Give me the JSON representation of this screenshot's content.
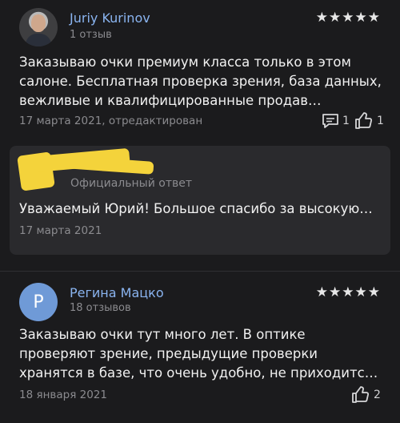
{
  "reviews": [
    {
      "author": "Juriy Kurinov",
      "reviews_count": "1 отзыв",
      "rating": 5,
      "stars": "★★★★★",
      "text": "Заказываю очки премиум класса только в этом салоне. Бесплатная проверка зрения, база данных, вежливые и квалифицированные продав…",
      "date": "17 марта 2021, отредактирован",
      "comments_count": "1",
      "likes_count": "1",
      "reply": {
        "label": "Официальный ответ",
        "text": "Уважаемый Юрий! Большое спасибо за высокую…",
        "date": "17 марта 2021"
      }
    },
    {
      "author": "Регина Мацко",
      "avatar_letter": "Р",
      "avatar_color": "#6f9ad7",
      "reviews_count": "18 отзывов",
      "rating": 5,
      "stars": "★★★★★",
      "text": "Заказываю очки тут много лет. В оптике проверяют зрение, предыдущие проверки хранятся в базе, что очень удобно, не приходитс…",
      "date": "18 января 2021",
      "likes_count": "2"
    }
  ],
  "icons": {
    "comment": "comment-icon",
    "like": "thumbs-up-icon",
    "redaction": "redaction-mark"
  },
  "colors": {
    "background": "#1b1b1d",
    "card": "#2a2a2d",
    "author": "#8ab4f0",
    "secondary": "#8b8b8f",
    "redaction": "#f4d33b"
  }
}
